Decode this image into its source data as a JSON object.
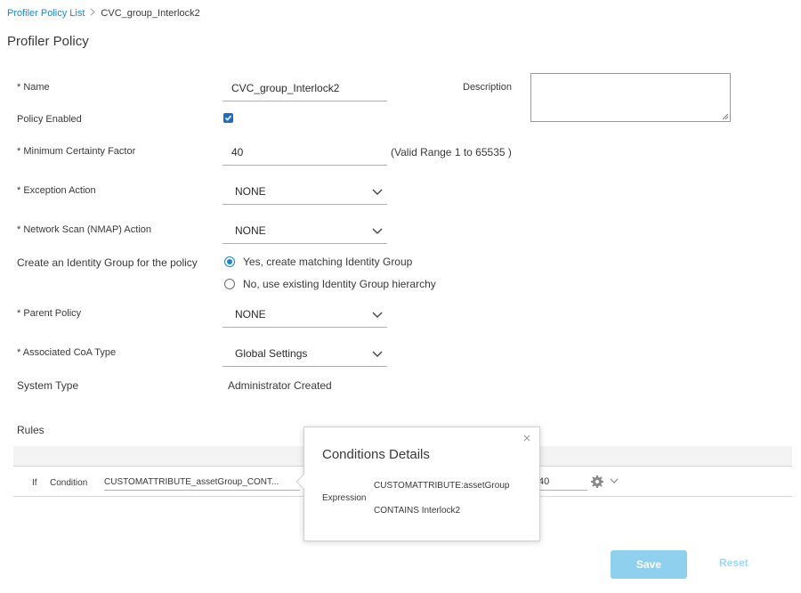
{
  "breadcrumb": {
    "parent": "Profiler Policy List",
    "current": "CVC_group_Interlock2"
  },
  "page_title": "Profiler Policy",
  "form": {
    "name_label": "* Name",
    "name_value": "CVC_group_Interlock2",
    "description_label": "Description",
    "description_value": "",
    "policy_enabled_label": "Policy Enabled",
    "policy_enabled": true,
    "mcf_label": "* Minimum Certainty Factor",
    "mcf_value": "40",
    "mcf_range": "(Valid Range 1 to 65535 )",
    "exception_action_label": "* Exception Action",
    "exception_action_value": "NONE",
    "nmap_label": "* Network Scan (NMAP) Action",
    "nmap_value": "NONE",
    "identity_group_label": "Create an Identity Group for the policy",
    "identity_group_options": [
      {
        "label": "Yes, create matching Identity Group",
        "selected": true
      },
      {
        "label": "No, use existing Identity Group hierarchy",
        "selected": false
      }
    ],
    "parent_policy_label": "* Parent Policy",
    "parent_policy_value": "NONE",
    "coa_label": "* Associated CoA Type",
    "coa_value": "Global Settings",
    "system_type_label": "System Type",
    "system_type_value": "Administrator Created"
  },
  "rules": {
    "title": "Rules",
    "row": {
      "if_label": "If",
      "condition_label": "Condition",
      "condition_value": "CUSTOMATTRIBUTE_assetGroup_CONT...",
      "then_value": "40"
    }
  },
  "popover": {
    "title": "Conditions Details",
    "expression_label": "Expression",
    "expression_line1": "CUSTOMATTRIBUTE:assetGroup",
    "expression_line2": "CONTAINS Interlock2"
  },
  "buttons": {
    "save": "Save",
    "reset": "Reset"
  },
  "colors": {
    "accent": "#1e86c9",
    "save_bg": "#8fd0ef",
    "reset_text": "#9fd6f1"
  }
}
